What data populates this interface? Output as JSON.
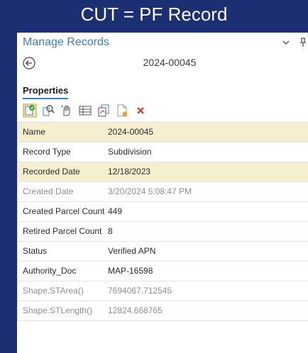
{
  "slide": {
    "title": "CUT = PF Record"
  },
  "pane": {
    "title": "Manage Records",
    "record_id": "2024-00045",
    "tab": "Properties"
  },
  "toolbar": {
    "icons": [
      "record-active-icon",
      "zoom-record-icon",
      "select-features-icon",
      "attribute-table-icon",
      "copy-lines-icon",
      "new-record-icon",
      "delete-icon"
    ]
  },
  "properties": [
    {
      "label": "Name",
      "value": "2024-00045",
      "highlight": true,
      "dim": false
    },
    {
      "label": "Record Type",
      "value": "Subdivision",
      "highlight": false,
      "dim": false
    },
    {
      "label": "Recorded Date",
      "value": "12/18/2023",
      "highlight": true,
      "dim": false
    },
    {
      "label": "Created Date",
      "value": "3/20/2024 5:08:47 PM",
      "highlight": false,
      "dim": true
    },
    {
      "label": "Created Parcel Count",
      "value": "449",
      "highlight": false,
      "dim": false
    },
    {
      "label": "Retired Parcel Count",
      "value": "8",
      "highlight": false,
      "dim": false
    },
    {
      "label": "Status",
      "value": "Verified APN",
      "highlight": false,
      "dim": false
    },
    {
      "label": "Authority_Doc",
      "value": "MAP-16598",
      "highlight": false,
      "dim": false
    },
    {
      "label": "Shape.STArea()",
      "value": "7694067.712545",
      "highlight": false,
      "dim": true
    },
    {
      "label": "Shape.STLength()",
      "value": "12824.668765",
      "highlight": false,
      "dim": true
    }
  ],
  "colors": {
    "slide_bg": "#1c2f72",
    "accent": "#3a7fc1",
    "highlight_row": "#f6efcf",
    "delete": "#d9342b"
  }
}
